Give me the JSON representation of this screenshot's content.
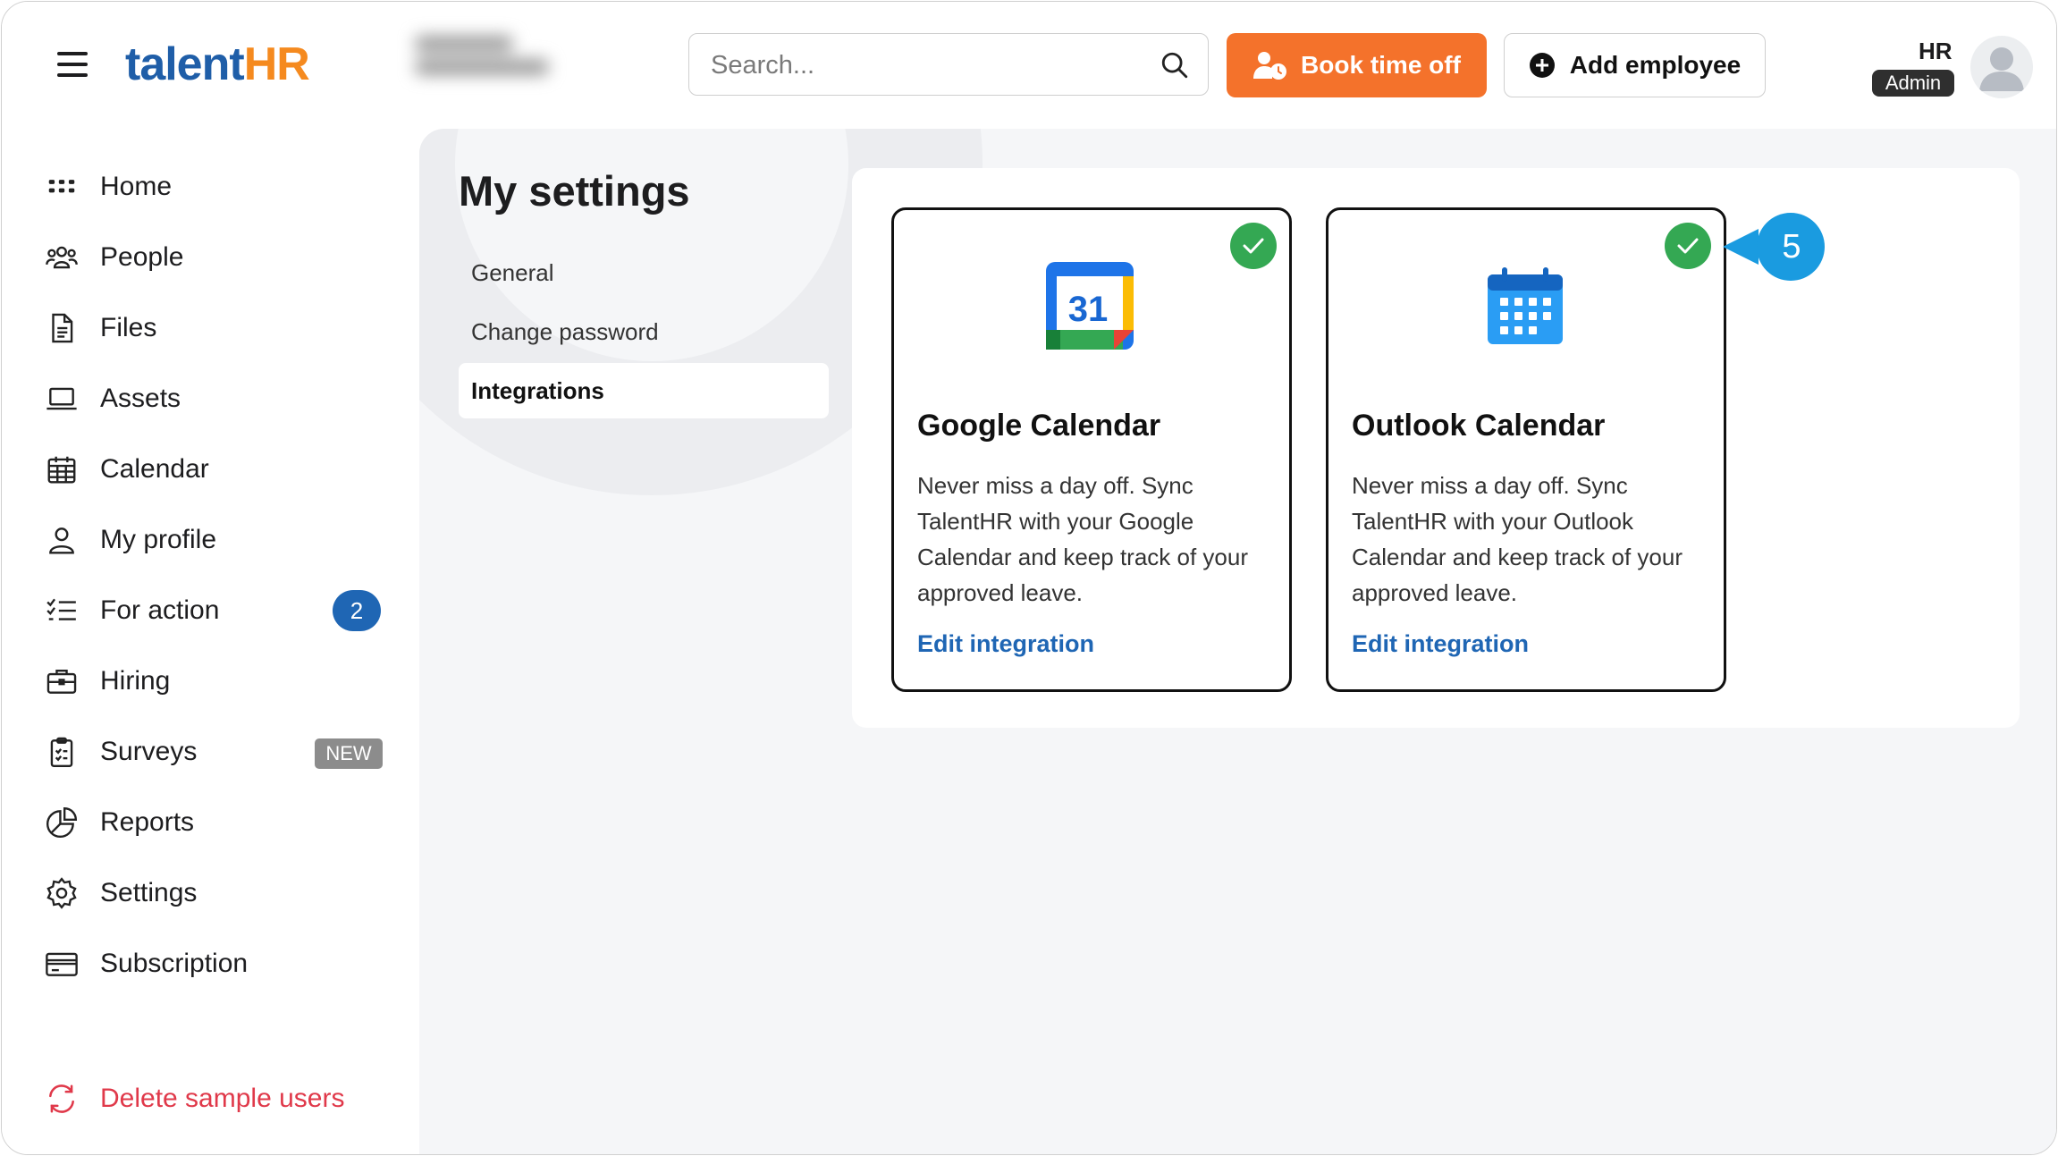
{
  "app": {
    "logo_part1": "talent",
    "logo_part2": "HR"
  },
  "search": {
    "placeholder": "Search..."
  },
  "header": {
    "book_label": "Book time off",
    "add_label": "Add employee",
    "user_name": "HR",
    "user_role": "Admin"
  },
  "sidebar": {
    "items": [
      {
        "label": "Home"
      },
      {
        "label": "People"
      },
      {
        "label": "Files"
      },
      {
        "label": "Assets"
      },
      {
        "label": "Calendar"
      },
      {
        "label": "My profile"
      },
      {
        "label": "For action",
        "badge": "2"
      },
      {
        "label": "Hiring"
      },
      {
        "label": "Surveys",
        "badge": "NEW"
      },
      {
        "label": "Reports"
      },
      {
        "label": "Settings"
      },
      {
        "label": "Subscription"
      }
    ],
    "delete_label": "Delete sample users"
  },
  "settings": {
    "title": "My settings",
    "nav": [
      "General",
      "Change password",
      "Integrations"
    ],
    "active_nav": "Integrations"
  },
  "integrations": [
    {
      "title": "Google Calendar",
      "description": "Never miss a day off. Sync TalentHR with your Google Calendar and keep track of your approved leave.",
      "link": "Edit integration",
      "icon_label": "31"
    },
    {
      "title": "Outlook Calendar",
      "description": "Never miss a day off. Sync TalentHR with your Outlook Calendar and keep track of your approved leave.",
      "link": "Edit integration"
    }
  ],
  "callout": {
    "number": "5"
  },
  "colors": {
    "brand_blue": "#1f5ea8",
    "brand_orange": "#f58a1f",
    "book_button": "#f4722b",
    "badge_blue": "#1f66b4",
    "check_green": "#34a853",
    "delete_red": "#e0394a",
    "callout_blue": "#1a9be0"
  }
}
